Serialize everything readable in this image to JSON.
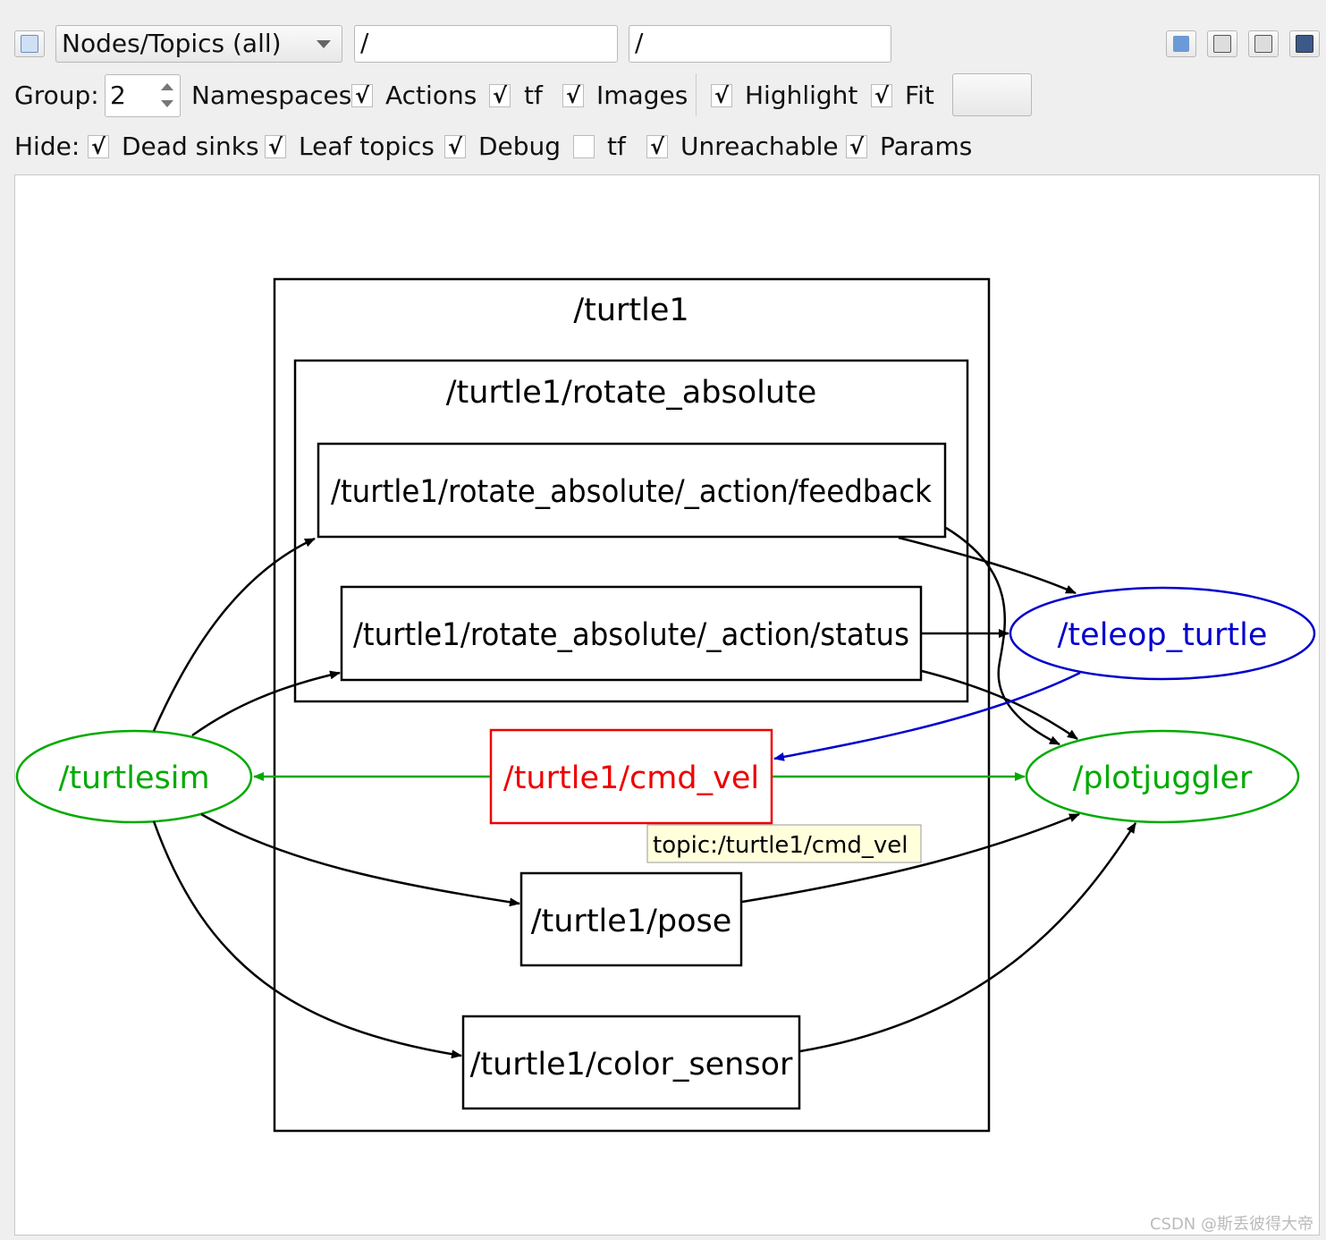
{
  "toolbar": {
    "refresh_icon": "refresh-icon",
    "mode_select": "Nodes/Topics (all)",
    "filter_node": "/",
    "filter_topic": "/",
    "right_icons": [
      "load-dot-icon",
      "save-dot-icon",
      "save-svg-icon",
      "save-image-icon"
    ]
  },
  "group_row": {
    "group_label": "Group:",
    "group_value": "2",
    "namespaces": "Namespaces",
    "actions": "Actions",
    "tf": "tf",
    "images": "Images",
    "highlight": "Highlight",
    "fit": "Fit",
    "checks": {
      "namespaces": true,
      "actions": true,
      "tf": true,
      "images": true,
      "highlight": true,
      "fit": true
    }
  },
  "hide_row": {
    "label": "Hide:",
    "dead_sinks": "Dead sinks",
    "leaf_topics": "Leaf topics",
    "debug": "Debug",
    "tf": "tf",
    "unreachable": "Unreachable",
    "params": "Params",
    "checks": {
      "dead_sinks": true,
      "leaf_topics": true,
      "debug": true,
      "tf": false,
      "unreachable": true,
      "params": true
    }
  },
  "check_glyph": "√",
  "graph": {
    "clusters": {
      "turtle1": "/turtle1",
      "rotate_absolute": "/turtle1/rotate_absolute"
    },
    "topics": {
      "feedback": "/turtle1/rotate_absolute/_action/feedback",
      "status": "/turtle1/rotate_absolute/_action/status",
      "cmd_vel": "/turtle1/cmd_vel",
      "pose": "/turtle1/pose",
      "color_sensor": "/turtle1/color_sensor"
    },
    "nodes": {
      "turtlesim": "/turtlesim",
      "teleop_turtle": "/teleop_turtle",
      "plotjuggler": "/plotjuggler"
    },
    "tooltip": "topic:/turtle1/cmd_vel",
    "colors": {
      "highlight_green": "#00aa00",
      "highlight_red": "#ee0000",
      "highlight_blue": "#0000cc",
      "default": "#000000"
    }
  },
  "watermark": "CSDN @斯丢彼得大帝"
}
